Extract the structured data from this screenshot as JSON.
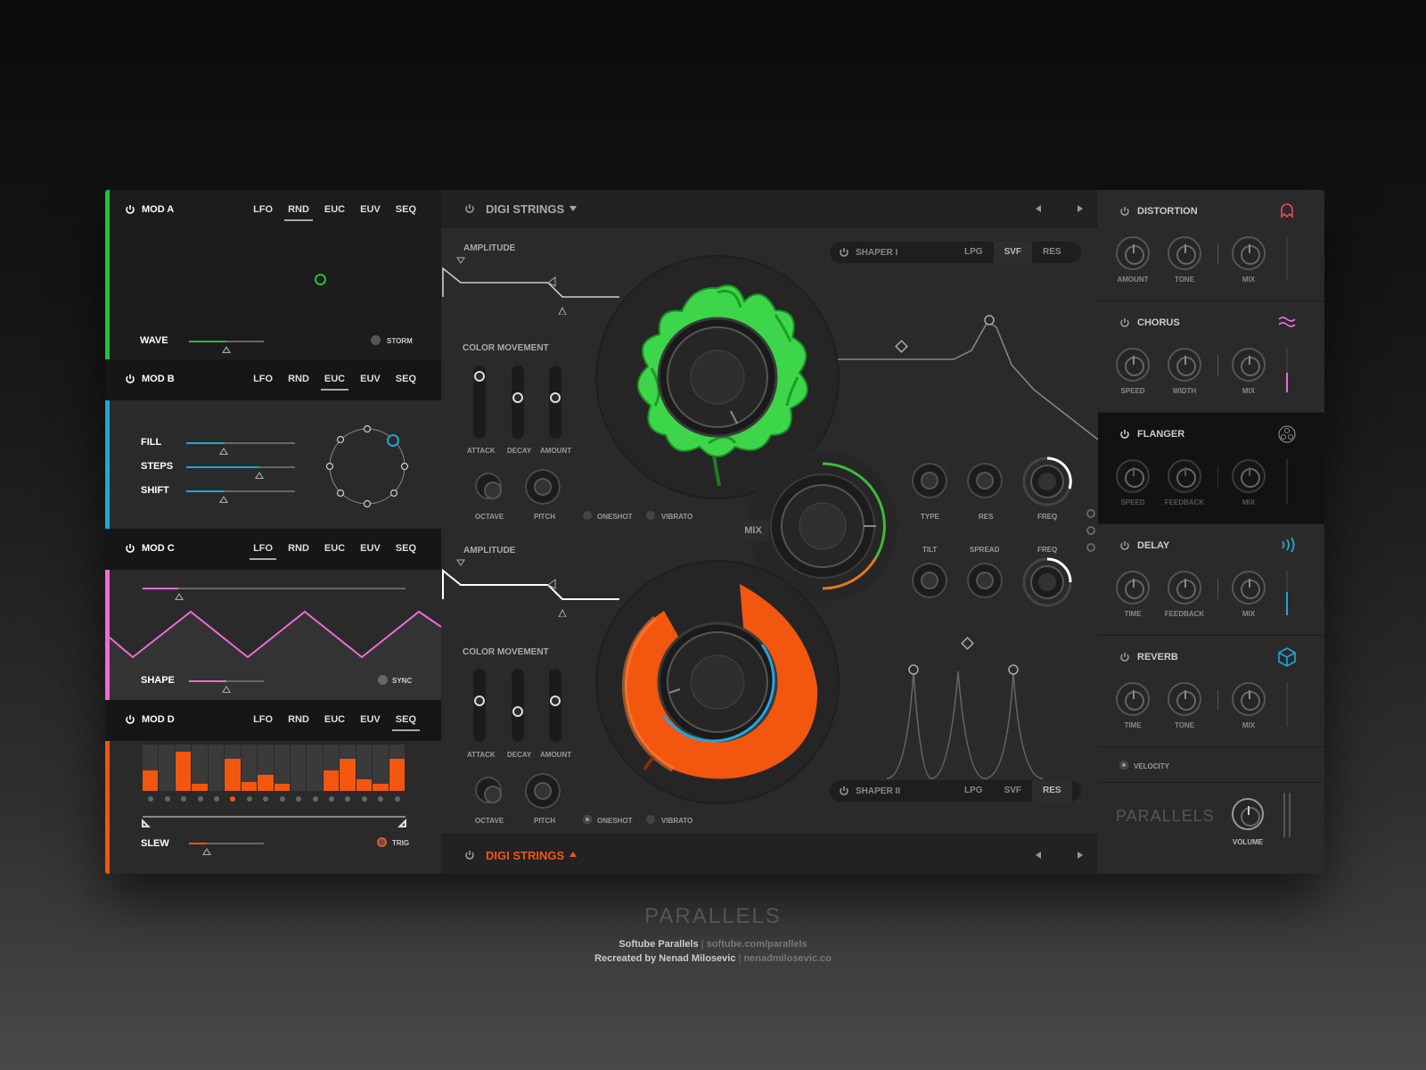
{
  "app": {
    "brand": "PARALLELS"
  },
  "credits": {
    "line1_name": "Softube Parallels",
    "line1_link": "softube.com/parallels",
    "line2_name": "Recreated by Nenad Milosevic",
    "line2_link": "nenadmilosevic.co"
  },
  "mods": {
    "tabs": [
      "LFO",
      "RND",
      "EUC",
      "EUV",
      "SEQ"
    ],
    "a": {
      "title": "MOD A",
      "active_tab": "RND",
      "color": "#1fc23b",
      "wave_label": "WAVE",
      "wave_value": 0.5,
      "toggle_label": "STORM"
    },
    "b": {
      "title": "MOD B",
      "active_tab": "EUC",
      "color": "#1fa8d0",
      "fill_label": "FILL",
      "fill_value": 0.35,
      "steps_label": "STEPS",
      "steps_value": 0.67,
      "shift_label": "SHIFT",
      "shift_value": 0.35
    },
    "c": {
      "title": "MOD C",
      "active_tab": "LFO",
      "color": "#f06ad8",
      "rate_value": 0.14,
      "shape_label": "SHAPE",
      "shape_value": 0.5,
      "toggle_label": "SYNC"
    },
    "d": {
      "title": "MOD D",
      "active_tab": "SEQ",
      "color": "#f2560f",
      "steps": [
        0.45,
        0.0,
        0.85,
        0.15,
        0.0,
        0.7,
        0.2,
        0.35,
        0.15,
        0.0,
        0.0,
        0.45,
        0.7,
        0.25,
        0.15,
        0.7
      ],
      "slew_label": "SLEW",
      "slew_value": 0.25,
      "toggle_label": "TRIG"
    }
  },
  "center": {
    "top_preset": "DIGI STRINGS",
    "bottom_preset": "DIGI STRINGS",
    "bottom_preset_color": "#f2560f",
    "amplitude_label": "AMPLITUDE",
    "color_movement_label": "COLOR MOVEMENT",
    "attack_label": "ATTACK",
    "decay_label": "DECAY",
    "amount_label": "AMOUNT",
    "octave_label": "OCTAVE",
    "pitch_label": "PITCH",
    "oneshot_label": "ONESHOT",
    "vibrato_label": "VIBRATO",
    "mix_label": "MIX",
    "shaper1": {
      "name": "SHAPER I",
      "modes": [
        "LPG",
        "SVF",
        "RES"
      ],
      "active": "SVF"
    },
    "shaper2": {
      "name": "SHAPER II",
      "modes": [
        "LPG",
        "SVF",
        "RES"
      ],
      "active": "RES"
    },
    "filter_labels_top": [
      "TYPE",
      "RES",
      "FREQ"
    ],
    "filter_labels_bottom": [
      "TILT",
      "SPREAD",
      "FREQ"
    ]
  },
  "effects": [
    {
      "name": "DISTORTION",
      "icon": "ghost-icon",
      "accent": "#e84a5f",
      "knobs": [
        "AMOUNT",
        "TONE",
        "MIX"
      ]
    },
    {
      "name": "CHORUS",
      "icon": "wave-icon",
      "accent": "#f06ad8",
      "knobs": [
        "SPEED",
        "WIDTH",
        "MIX"
      ]
    },
    {
      "name": "FLANGER",
      "icon": "circles-icon",
      "accent": "#888888",
      "knobs": [
        "SPEED",
        "FEEDBACK",
        "MIX"
      ]
    },
    {
      "name": "DELAY",
      "icon": "echo-icon",
      "accent": "#1fa8d0",
      "knobs": [
        "TIME",
        "FEEDBACK",
        "MIX"
      ]
    },
    {
      "name": "REVERB",
      "icon": "cube-icon",
      "accent": "#1fa8d0",
      "knobs": [
        "TIME",
        "TONE",
        "MIX"
      ]
    }
  ],
  "velocity_label": "VELOCITY",
  "volume_label": "VOLUME"
}
